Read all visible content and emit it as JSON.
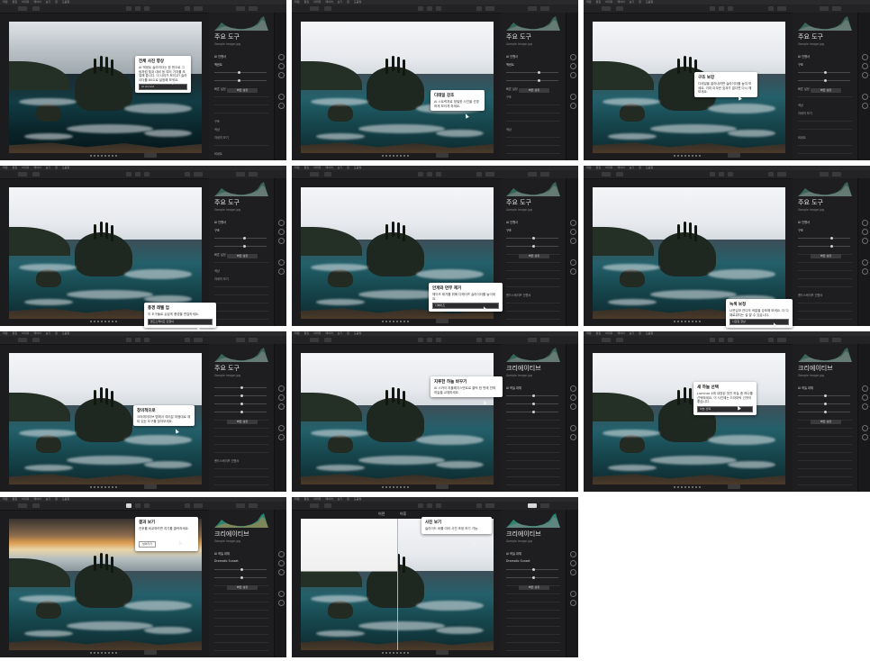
{
  "menu": [
    "파일",
    "편집",
    "이미지",
    "레이어",
    "보기",
    "창",
    "도움말"
  ],
  "colors": {
    "panel_bg": "#1c1c1e",
    "sidebar_bg": "#1e1e20",
    "accent": "#e2b04b",
    "tooltip_bg": "#ffffff"
  },
  "panels": [
    {
      "sidebar": {
        "title": "주요 도구",
        "subtitle": "Sample Image.jpg",
        "rows": [
          "AI 인핸서",
          "액센트",
          "",
          "",
          "빠른 설정",
          "",
          "",
          "",
          "구조",
          "색상",
          "자세히 보기",
          "",
          "비네트"
        ],
        "button": "빠른 설정"
      },
      "tip": {
        "title": "전체 사진 향상",
        "body": "AI 엑센트 슬라이더는 한 번으로 그림처럼 빛과 대비 등 여러 가지를 조절해 줍니다. 더 나아가 보이고? 슬라이더를 80으로 설정해 보세요.",
        "field": "AI Accent"
      }
    },
    {
      "sidebar": {
        "title": "주요 도구",
        "subtitle": "Sample Image.jpg",
        "rows": [
          "AI 인핸서",
          "액센트",
          "",
          "",
          "빠른 설정",
          "구조",
          "",
          "",
          "",
          "색상",
          "",
          "",
          ""
        ],
        "button": "빠른 설정"
      },
      "tip": {
        "title": "디테일 강조",
        "body": "AI 스트럭처로 정밀한 사진을 선명하게 보이게 하세요.",
        "field": ""
      }
    },
    {
      "sidebar": {
        "title": "주요 도구",
        "subtitle": "Sample Image.jpg",
        "rows": [
          "AI 인핸서",
          "구조",
          "",
          "",
          "빠른 설정",
          "",
          "색상",
          "자세히 보기",
          "",
          "",
          "비네트",
          "",
          ""
        ],
        "button": "빠른 설정"
      },
      "tip": {
        "title": "구조 보강",
        "body": "디테일을 끌어내려면 슬라이더를 높여 보세요. 이미 아무런 효과가 없다면 다시 해 보세요.",
        "field": ""
      }
    },
    {
      "sidebar": {
        "title": "주요 도구",
        "subtitle": "Sample Image.jpg",
        "rows": [
          "AI 인핸서",
          "구조",
          "",
          "",
          "빠른 설정",
          "",
          "색상",
          "자세히 보기",
          "",
          "",
          "",
          "",
          ""
        ],
        "button": "빠른 설정"
      },
      "tip": {
        "title": "풍경 레벨 업",
        "body": "이 도구들로 손쉽게 풍경을 편집하세요.",
        "field": "랜드스케이프 인핸서"
      }
    },
    {
      "sidebar": {
        "title": "주요 도구",
        "subtitle": "Sample Image.jpg",
        "rows": [
          "AI 인핸서",
          "구조",
          "",
          "",
          "",
          "",
          "",
          "",
          "",
          "랜드스케이프 인핸서",
          "",
          "",
          ""
        ],
        "button": "빠른 설정"
      },
      "tip": {
        "title": "안개와 연무 제거",
        "body": "헤이즈 제거를 위해 디헤이즈 슬라이더를 높이세요.",
        "field": "디헤이즈"
      }
    },
    {
      "sidebar": {
        "title": "주요 도구",
        "subtitle": "Sample Image.jpg",
        "rows": [
          "AI 인핸서",
          "구조",
          "",
          "",
          "",
          "",
          "",
          "",
          "",
          "랜드스케이프 인핸서",
          "",
          "",
          ""
        ],
        "button": "빠른 설정"
      },
      "tip": {
        "title": "녹색 보정",
        "body": "나뭇잎과 잔디의 색깔을 강조해 보세요. 더 다채로워지는 걸 알 수 있습니다.",
        "field": "나뭇잎 향상"
      }
    },
    {
      "sidebar": {
        "title": "주요 도구",
        "subtitle": "Sample Image.jpg",
        "rows": [
          "",
          "",
          "",
          "",
          "",
          "",
          "",
          "",
          "",
          "랜드스케이프 인핸서",
          "",
          "",
          ""
        ],
        "button": "빠른 설정"
      },
      "tip": {
        "title": "창의적으로",
        "body": "크리에이티브 탭에서 여러분 마음대로 재미 있는 도구를 찾아보세요.",
        "field": ""
      }
    },
    {
      "sidebar": {
        "title": "크리에이티브",
        "subtitle": "Sample Image.jpg",
        "rows": [
          "AI 하늘 대체",
          "",
          "",
          "",
          "",
          "",
          "",
          "",
          "",
          "",
          "",
          "",
          ""
        ],
        "button": ""
      },
      "tip": {
        "title": "지루한 하늘 바꾸기",
        "body": "AI 스카이 리플레이스먼트로 클릭 한 번에 전체 하늘을 교체하세요.",
        "field": ""
      }
    },
    {
      "sidebar": {
        "title": "크리에이티브",
        "subtitle": "Sample Image.jpg",
        "rows": [
          "AI 하늘 대체",
          "",
          "",
          "",
          "",
          "",
          "",
          "",
          "",
          "",
          "",
          "",
          ""
        ],
        "button": "빠른 설정"
      },
      "tip": {
        "title": "새 하늘 선택",
        "body": "Luminar 4에 내장된 멋진 하늘 중 하나를 선택하세요. 이 사진에는 드라마틱 선셋이 좋습니다.",
        "field": "하늘 선택"
      }
    },
    {
      "sidebar": {
        "title": "크리에이티브",
        "subtitle": "Sample Image.jpg",
        "rows": [
          "AI 하늘 대체",
          "Dramatic Sunset",
          "",
          "",
          "",
          "",
          "",
          "",
          "",
          "",
          "",
          "",
          ""
        ],
        "button": "빠른 설정"
      },
      "tip": {
        "title": "결과 보기",
        "body": "전후를 비교하려면 여기를 클릭하세요.",
        "field": ""
      },
      "tip_button": "넘어가기"
    },
    {
      "sidebar": {
        "title": "크리에이티브",
        "subtitle": "Sample Image.jpg",
        "rows": [
          "AI 하늘 대체",
          "Dramatic Sunset",
          "",
          "",
          "",
          "",
          "",
          "",
          "",
          "",
          "",
          "",
          ""
        ],
        "button": "빠른 설정"
      },
      "tip": {
        "title": "사진 보기",
        "body": "슬라이드 바를 여러 사진 조정 보기 가능.",
        "field": ""
      },
      "before_label": "이전",
      "after_label": "이후"
    }
  ]
}
